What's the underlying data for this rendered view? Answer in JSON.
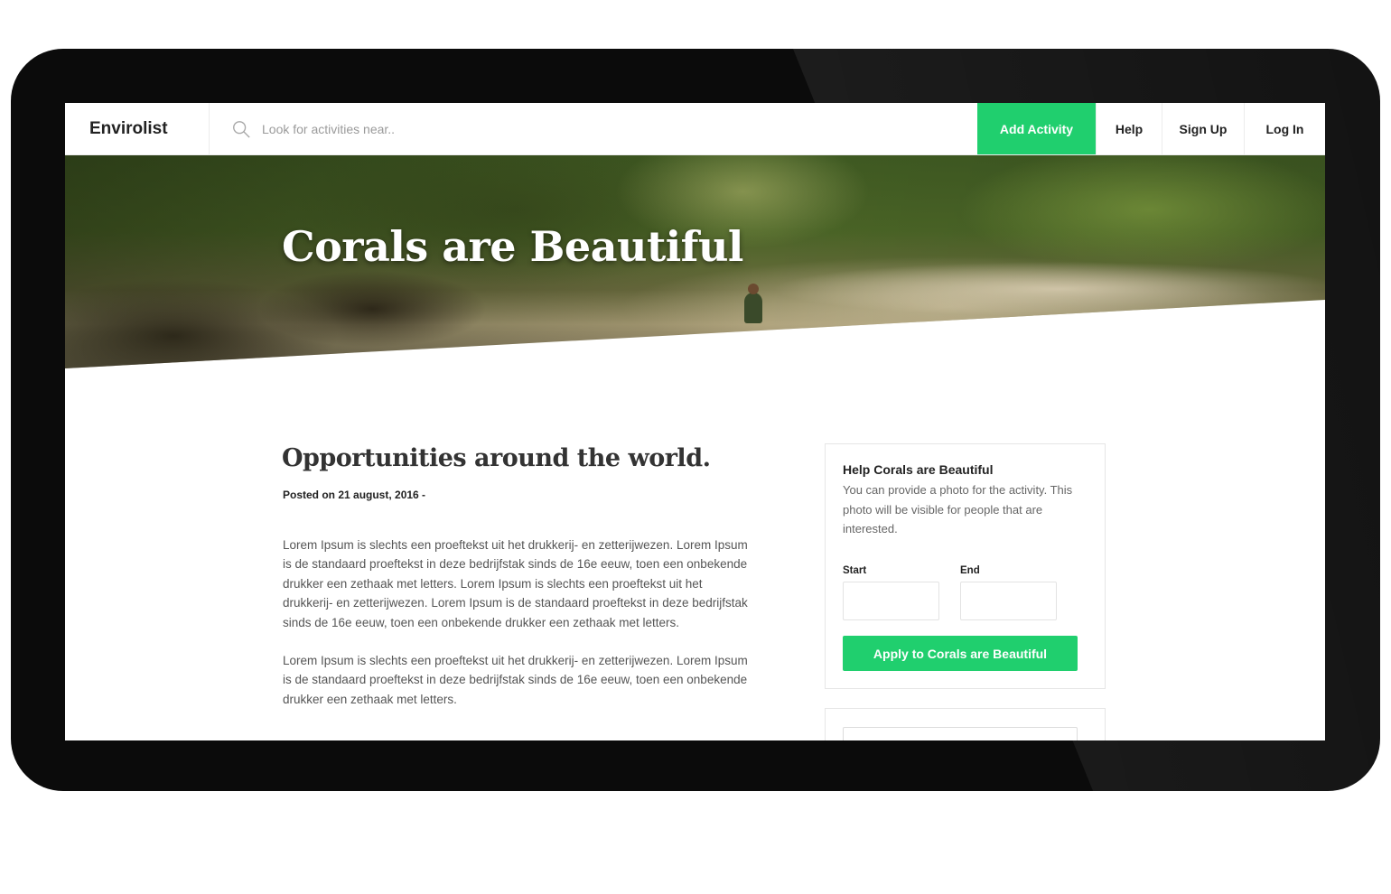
{
  "nav": {
    "brand": "Envirolist",
    "search_placeholder": "Look for activities near..",
    "add_activity": "Add Activity",
    "help": "Help",
    "sign_up": "Sign Up",
    "log_in": "Log In"
  },
  "hero": {
    "title": "Corals are Beautiful"
  },
  "article": {
    "title": "Opportunities around the world.",
    "date": "Posted on 21 august, 2016 -",
    "paragraphs": [
      "Lorem Ipsum is slechts een proeftekst uit het drukkerij- en zetterijwezen. Lorem Ipsum is de standaard proeftekst in deze bedrijfstak sinds de 16e eeuw, toen een onbekende drukker een zethaak met letters. Lorem Ipsum is slechts een proeftekst uit het drukkerij- en zetterijwezen. Lorem Ipsum is de standaard proeftekst in deze bedrijfstak sinds de 16e eeuw, toen een onbekende drukker een zethaak met letters.",
      "Lorem Ipsum is slechts een proeftekst uit het drukkerij- en zetterijwezen. Lorem Ipsum is de standaard proeftekst in deze bedrijfstak sinds de 16e eeuw, toen een onbekende drukker een zethaak met letters."
    ]
  },
  "sidebar": {
    "title": "Help Corals are Beautiful",
    "text": "You can provide a photo for the activity. This photo will be visible for people that are interested.",
    "start_label": "Start",
    "end_label": "End",
    "start_value": "",
    "end_value": "",
    "apply_button": "Apply to Corals are Beautiful"
  },
  "colors": {
    "accent": "#20cf6e"
  }
}
